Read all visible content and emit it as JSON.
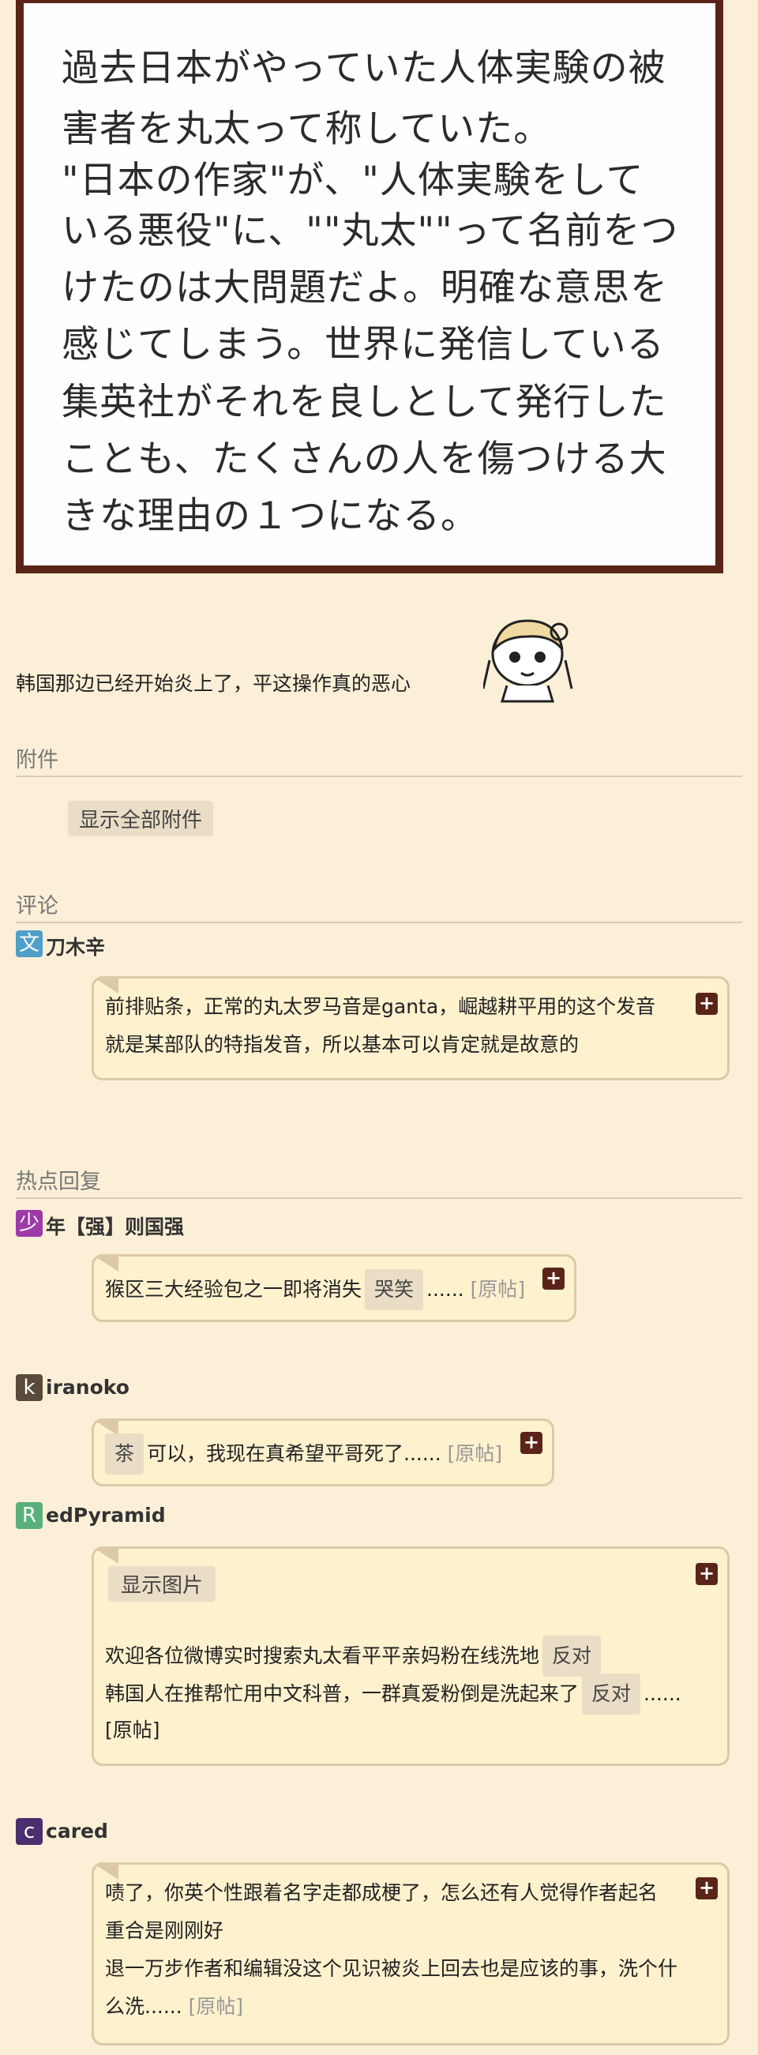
{
  "quote": {
    "lines": [
      "過去日本がやっていた人体実験の被",
      "害者を丸太って称していた。",
      "\"日本の作家\"が、\"人体実験をして",
      "いる悪役\"に、\"\"丸太\"\"って名前をつ",
      "けたのは大問題だよ。明確な意思を",
      "感じてしまう。世界に発信している",
      "集英社がそれを良しとして発行した",
      "ことも、たくさんの人を傷つける大",
      "きな理由の１つになる。"
    ]
  },
  "post_text": "韩国那边已经开始炎上了，平这操作真的恶心",
  "attachments": {
    "title": "附件",
    "show_all": "显示全部附件"
  },
  "comments": {
    "title": "评论",
    "items": [
      {
        "avatar_letter": "文",
        "avatar_color": "#4f9fc9",
        "username": "刀木辛",
        "lines": [
          "前排贴条，正常的丸太罗马音是ganta，崛越耕平用的这个发音",
          "就是某部队的特指发音，所以基本可以肯定就是故意的"
        ]
      }
    ]
  },
  "hot_replies": {
    "title": "热点回复",
    "items": [
      {
        "avatar_letter": "少",
        "avatar_color": "#9d3aa8",
        "username": "年【强】则国强",
        "text_before": "猴区三大经验包之一即将消失",
        "tag": "哭笑",
        "text_after": "......",
        "original": "[原帖]"
      },
      {
        "avatar_letter": "k",
        "avatar_color": "#5a4a3c",
        "username": "iranoko",
        "tag": "茶",
        "text_after": "可以，我现在真希望平哥死了......",
        "original": "[原帖]"
      },
      {
        "avatar_letter": "R",
        "avatar_color": "#5ab07a",
        "username": "edPyramid",
        "show_image": "显示图片",
        "line1": "欢迎各位微博实时搜索丸太看平平亲妈粉在线洗地",
        "tag1": "反对",
        "line2": "韩国人在推帮忙用中文科普，一群真爱粉倒是洗起来了",
        "tag2": "反对",
        "line2_after": "......",
        "original": "[原帖]"
      },
      {
        "avatar_letter": "c",
        "avatar_color": "#4a2f6e",
        "username": "cared",
        "lines": [
          "啧了，你英个性跟着名字走都成梗了，怎么还有人觉得作者起名",
          "重合是刚刚好",
          "退一万步作者和编辑没这个见识被炎上回去也是应该的事，洗个什"
        ],
        "last_line": "么洗......",
        "original": "[原帖]"
      }
    ]
  },
  "plus_symbol": "+",
  "colors": {
    "background": "#fbf0d7",
    "accent": "#5b2419",
    "bubble": "#fdf1ce"
  }
}
